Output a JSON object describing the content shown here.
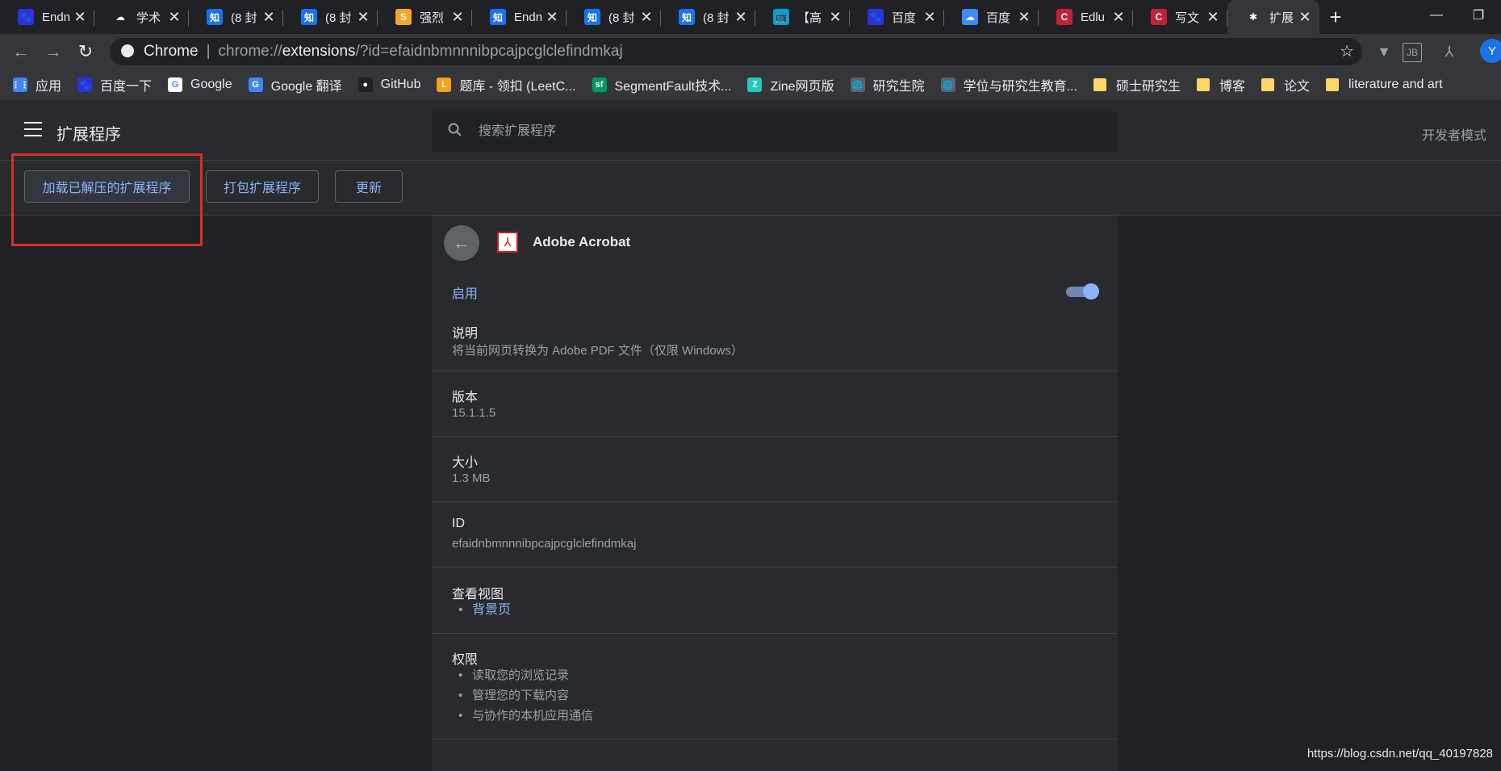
{
  "tabs": [
    {
      "title": "Endn",
      "icon": "baidu-paw-icon",
      "color": "#2932e1",
      "glyph": "🐾"
    },
    {
      "title": "学术",
      "icon": "cloud-icon",
      "color": "#202124",
      "glyph": "☁"
    },
    {
      "title": "(8 封",
      "icon": "zhihu-icon",
      "color": "#1772f6",
      "glyph": "知"
    },
    {
      "title": "(8 封",
      "icon": "zhihu-icon",
      "color": "#1772f6",
      "glyph": "知"
    },
    {
      "title": "强烈",
      "icon": "qiangli-icon",
      "color": "#f5a623",
      "glyph": "S"
    },
    {
      "title": "Endn",
      "icon": "zhihu-icon",
      "color": "#1772f6",
      "glyph": "知"
    },
    {
      "title": "(8 封",
      "icon": "zhihu-icon",
      "color": "#1772f6",
      "glyph": "知"
    },
    {
      "title": "(8 封",
      "icon": "zhihu-icon",
      "color": "#1772f6",
      "glyph": "知"
    },
    {
      "title": "【高",
      "icon": "bilibili-icon",
      "color": "#00a1d6",
      "glyph": "📺"
    },
    {
      "title": "百度",
      "icon": "baidu-paw-icon",
      "color": "#2932e1",
      "glyph": "🐾"
    },
    {
      "title": "百度",
      "icon": "baidu-netdisk-icon",
      "color": "#3b8cff",
      "glyph": "☁"
    },
    {
      "title": "Edlu",
      "icon": "csdn-icon",
      "color": "#c32136",
      "glyph": "C"
    },
    {
      "title": "写文",
      "icon": "csdn-icon",
      "color": "#c32136",
      "glyph": "C"
    },
    {
      "title": "扩展",
      "icon": "puzzle-icon",
      "color": "#35363a",
      "glyph": "✱",
      "active": true
    }
  ],
  "omnibox": {
    "site_label": "Chrome",
    "url_prefix": "chrome://",
    "url_host": "extensions",
    "url_rest": "/?id=efaidnbmnnnibpcajpcglclefindmkaj"
  },
  "bookmarks": [
    {
      "label": "应用",
      "icon": "apps-grid-icon",
      "color": "#4285f4",
      "glyph": "⋮⋮"
    },
    {
      "label": "百度一下",
      "icon": "baidu-paw-icon",
      "color": "#2932e1",
      "glyph": "🐾"
    },
    {
      "label": "Google",
      "icon": "google-icon",
      "color": "#ffffff",
      "glyph": "G"
    },
    {
      "label": "Google 翻译",
      "icon": "google-translate-icon",
      "color": "#4285f4",
      "glyph": "G"
    },
    {
      "label": "GitHub",
      "icon": "github-icon",
      "color": "#202124",
      "glyph": "●"
    },
    {
      "label": "题库 - 领扣 (LeetC...",
      "icon": "leetcode-icon",
      "color": "#f89f1b",
      "glyph": "L"
    },
    {
      "label": "SegmentFault技术...",
      "icon": "segmentfault-icon",
      "color": "#009a61",
      "glyph": "sf"
    },
    {
      "label": "Zine网页版",
      "icon": "zine-icon",
      "color": "#20c9b8",
      "glyph": "Z"
    },
    {
      "label": "研究生院",
      "icon": "globe-icon",
      "color": "#5f6368",
      "glyph": "🌐"
    },
    {
      "label": "学位与研究生教育...",
      "icon": "globe-icon",
      "color": "#5f6368",
      "glyph": "🌐"
    },
    {
      "label": "硕士研究生",
      "icon": "folder-icon",
      "folder": true
    },
    {
      "label": "博客",
      "icon": "folder-icon",
      "folder": true
    },
    {
      "label": "论文",
      "icon": "folder-icon",
      "folder": true
    },
    {
      "label": "literature and art",
      "icon": "folder-icon",
      "folder": true
    }
  ],
  "header": {
    "title": "扩展程序",
    "search_placeholder": "搜索扩展程序",
    "dev_mode_label": "开发者模式"
  },
  "dev_buttons": {
    "load_unpacked": "加载已解压的扩展程序",
    "pack": "打包扩展程序",
    "update": "更新"
  },
  "extension": {
    "name": "Adobe Acrobat",
    "enabled": true,
    "enable_label": "启用",
    "description_label": "说明",
    "description": "将当前网页转换为 Adobe PDF 文件（仅限 Windows）",
    "version_label": "版本",
    "version": "15.1.1.5",
    "size_label": "大小",
    "size": "1.3 MB",
    "id_label": "ID",
    "id": "efaidnbmnnnibpcajpcglclefindmkaj",
    "views_label": "查看视图",
    "views": [
      "背景页"
    ],
    "permissions_label": "权限",
    "permissions": [
      "读取您的浏览记录",
      "管理您的下载内容",
      "与协作的本机应用通信"
    ]
  },
  "watermark": "https://blog.csdn.net/qq_40197828",
  "profile_initial": "Y",
  "highlight_color": "#d93025",
  "accent_color": "#8ab4f8"
}
